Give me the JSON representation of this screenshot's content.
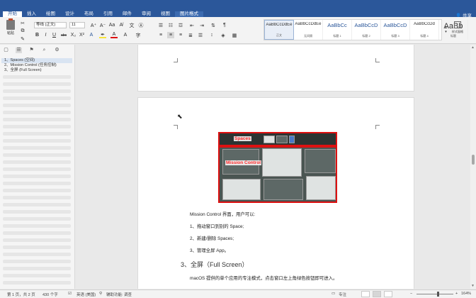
{
  "ribbon_tabs": [
    {
      "label": "开始",
      "active": true
    },
    {
      "label": "插入"
    },
    {
      "label": "绘图"
    },
    {
      "label": "设计"
    },
    {
      "label": "布局"
    },
    {
      "label": "引用"
    },
    {
      "label": "邮件"
    },
    {
      "label": "审阅"
    },
    {
      "label": "视图"
    },
    {
      "label": "图片格式",
      "contextual": true
    }
  ],
  "share_label": "共享",
  "toolbar": {
    "paste_label": "粘贴",
    "font_name": "等线 (正文)",
    "font_size": "11",
    "styles": [
      {
        "preview": "AaBbCcDdEe",
        "name": "正文",
        "selected": true
      },
      {
        "preview": "AaBbCcDdEe",
        "name": "无间隔"
      },
      {
        "preview": "AaBbCc",
        "name": "标题 1"
      },
      {
        "preview": "AaBbCcD",
        "name": "标题 2"
      },
      {
        "preview": "AaBbCcD",
        "name": "标题 3"
      },
      {
        "preview": "AaBbCcDd",
        "name": "标题 4"
      },
      {
        "preview": "AaBb",
        "name": "标题"
      }
    ],
    "styles_pane_label": "样式窗格",
    "accent_color": "#2b579a"
  },
  "sidebar": {
    "outline": [
      {
        "label": "1、Spaces (空间)",
        "active": true
      },
      {
        "label": "2、Mission Control (任务控制)"
      },
      {
        "label": "3、全屏 (Full Screen)"
      }
    ]
  },
  "document": {
    "figure_labels": {
      "spaces": "Spaces",
      "mission_control": "Mission Control"
    },
    "body_intro": "Mission Control 界面，用户可以:",
    "list_items": [
      "1、拖动窗口到别的 Space;",
      "2、新建/删除 Spaces;",
      "3、管理全屏 App。"
    ],
    "heading3": "3、全屏（Full Screen）",
    "heading3_body": "macOS 提供的单个应用的专注模式，点击窗口左上角绿色按钮即可进入。"
  },
  "status_bar": {
    "page": "第 1 页，共 2 页",
    "words": "430 个字",
    "language": "英语 (美国)",
    "accessibility": "辅助功能: 调查",
    "focus": "专注",
    "zoom": "164%"
  }
}
